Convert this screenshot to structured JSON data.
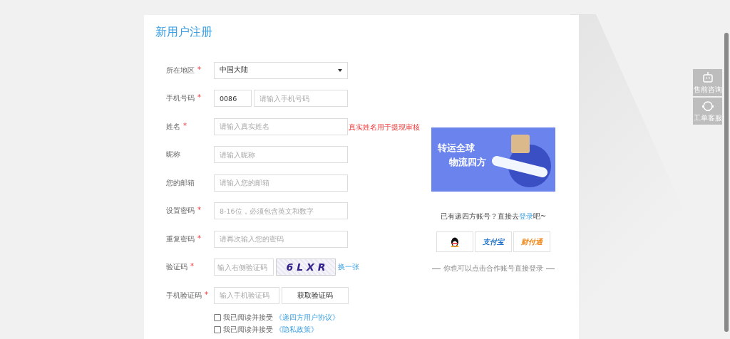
{
  "title": "新用户注册",
  "fields": [
    {
      "kind": "select",
      "label": "所在地区",
      "required": true,
      "value": "中国大陆"
    },
    {
      "kind": "phone",
      "label": "手机号码",
      "required": true,
      "prefix": "0086",
      "placeholder": "请输入手机号码"
    },
    {
      "kind": "text",
      "label": "姓名",
      "required": true,
      "placeholder": "请输入真实姓名",
      "hint": "真实姓名用于提现审核"
    },
    {
      "kind": "text",
      "label": "昵称",
      "required": false,
      "placeholder": "请输入昵称"
    },
    {
      "kind": "text",
      "label": "您的邮箱",
      "required": false,
      "placeholder": "请输入您的邮箱"
    },
    {
      "kind": "text",
      "label": "设置密码",
      "required": true,
      "placeholder": "8-16位，必须包含英文和数字"
    },
    {
      "kind": "text",
      "label": "重复密码",
      "required": true,
      "placeholder": "请再次输入您的密码"
    },
    {
      "kind": "captcha",
      "label": "验证码",
      "required": true,
      "placeholder": "输入右侧验证码",
      "captcha": "6 L X R",
      "refresh": "换一张"
    },
    {
      "kind": "sms",
      "label": "手机验证码",
      "required": true,
      "placeholder": "输入手机验证码",
      "button": "获取验证码"
    }
  ],
  "required_mark": "*",
  "agreements": [
    {
      "text": "我已阅读并接受",
      "link": "《递四方用户协议》",
      "checked": false
    },
    {
      "text": "我已阅读并接受",
      "link": "《隐私政策》",
      "checked": false
    }
  ],
  "banner": {
    "line1": "转运全球",
    "line2": "物流四方"
  },
  "login_prompt": {
    "before": "已有递四方账号？直接去",
    "link": "登录",
    "after": "吧~"
  },
  "social": [
    {
      "kind": "qq"
    },
    {
      "kind": "alipay",
      "label": "支付宝"
    },
    {
      "kind": "tenpay",
      "label": "财付通"
    }
  ],
  "partner_note": "你也可以点击合作账号直接登录",
  "side_buttons": [
    {
      "kind": "robot",
      "label": "售前咨询"
    },
    {
      "kind": "headset",
      "label": "工单客服"
    }
  ]
}
